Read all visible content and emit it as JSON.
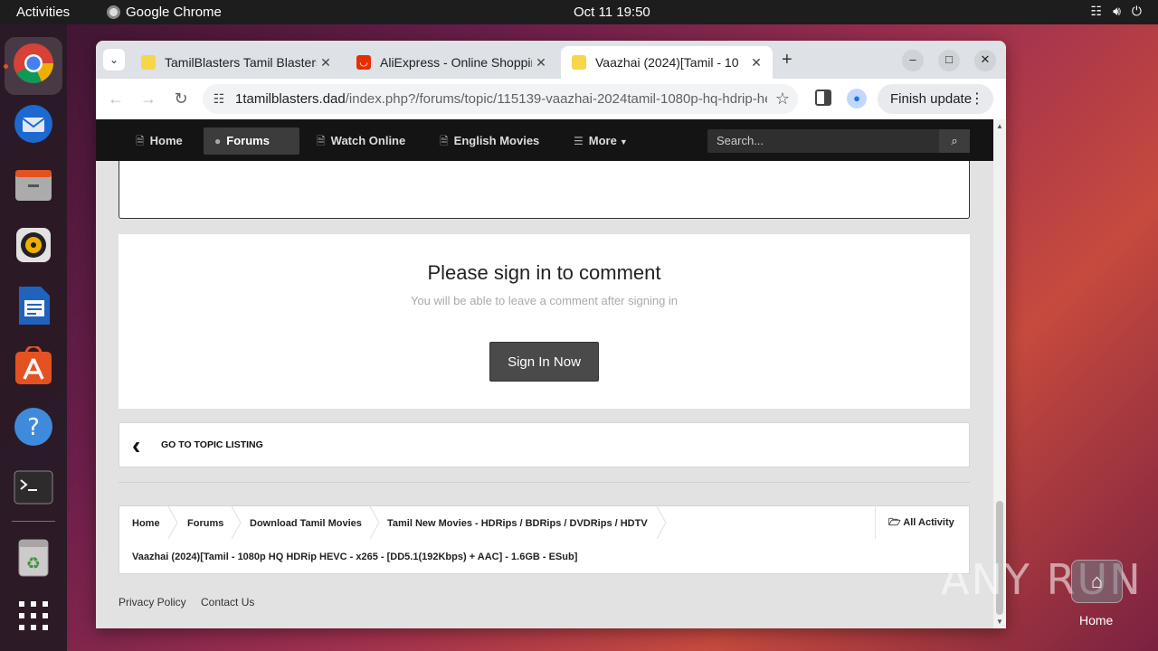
{
  "topbar": {
    "activities": "Activities",
    "app_name": "Google Chrome",
    "clock": "Oct 11  19:50"
  },
  "dock": {
    "items": [
      {
        "name": "Chrome",
        "icon": "chrome-icon"
      },
      {
        "name": "Thunderbird",
        "icon": "thunderbird-icon"
      },
      {
        "name": "Files",
        "icon": "files-icon"
      },
      {
        "name": "Rhythmbox",
        "icon": "rhythmbox-icon"
      },
      {
        "name": "LibreOffice Writer",
        "icon": "writer-icon"
      },
      {
        "name": "App Center",
        "icon": "app-center-icon"
      },
      {
        "name": "Help",
        "icon": "help-icon"
      },
      {
        "name": "Terminal",
        "icon": "terminal-icon"
      },
      {
        "name": "Trash",
        "icon": "trash-icon"
      },
      {
        "name": "Show Apps",
        "icon": "grid-icon"
      }
    ]
  },
  "browser": {
    "tabs": [
      {
        "title": "TamilBlasters Tamil Blasters",
        "active": false
      },
      {
        "title": "AliExpress - Online Shopping",
        "active": false
      },
      {
        "title": "Vaazhai (2024)[Tamil - 10",
        "active": true
      }
    ],
    "url_domain": "1tamilblasters.dad",
    "url_path": "/index.php?/forums/topic/115139-vaazhai-2024tamil-1080p-hq-hdrip-he...",
    "finish_update": "Finish update"
  },
  "site": {
    "nav": [
      {
        "label": "Home",
        "icon": "document-icon",
        "active": false
      },
      {
        "label": "Forums",
        "icon": "chat-icon",
        "active": true
      },
      {
        "label": "Watch Online",
        "icon": "document-icon",
        "active": false
      },
      {
        "label": "English Movies",
        "icon": "document-icon",
        "active": false
      },
      {
        "label": "More",
        "icon": "menu-icon",
        "active": false
      }
    ],
    "search_placeholder": "Search...",
    "signin": {
      "heading": "Please sign in to comment",
      "sub": "You will be able to leave a comment after signing in",
      "button": "Sign In Now"
    },
    "goto_topic": "GO TO TOPIC LISTING",
    "breadcrumb": {
      "items": [
        "Home",
        "Forums",
        "Download Tamil Movies",
        "Tamil New Movies - HDRips / BDRips / DVDRips / HDTV"
      ],
      "current": "Vaazhai (2024)[Tamil - 1080p HQ HDRip HEVC - x265 - [DD5.1(192Kbps) + AAC] - 1.6GB - ESub]",
      "all_activity": "All Activity"
    },
    "footer": {
      "privacy": "Privacy Policy",
      "contact": "Contact Us"
    }
  },
  "overlay": {
    "watermark": "ANY RUN",
    "home_label": "Home"
  }
}
